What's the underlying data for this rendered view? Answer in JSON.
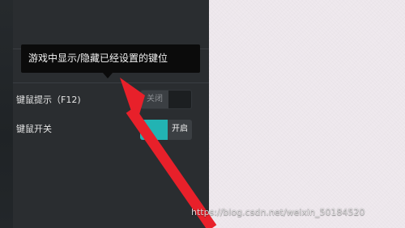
{
  "tooltip": {
    "text": "游戏中显示/隐藏已经设置的键位"
  },
  "settings": {
    "rows": [
      {
        "label": "键鼠提示（F12)",
        "toggle_text": "关闭",
        "state": "off"
      },
      {
        "label": "键鼠开关",
        "toggle_text": "开启",
        "state": "on"
      }
    ]
  },
  "watermark": {
    "text": "https://blog.csdn.net/weixin_50184520"
  },
  "colors": {
    "panel": "#2a2d30",
    "toggle_on": "#22b3b3",
    "annotation_arrow": "#e8202a"
  },
  "icons": {
    "annotation": "red-arrow-icon"
  }
}
